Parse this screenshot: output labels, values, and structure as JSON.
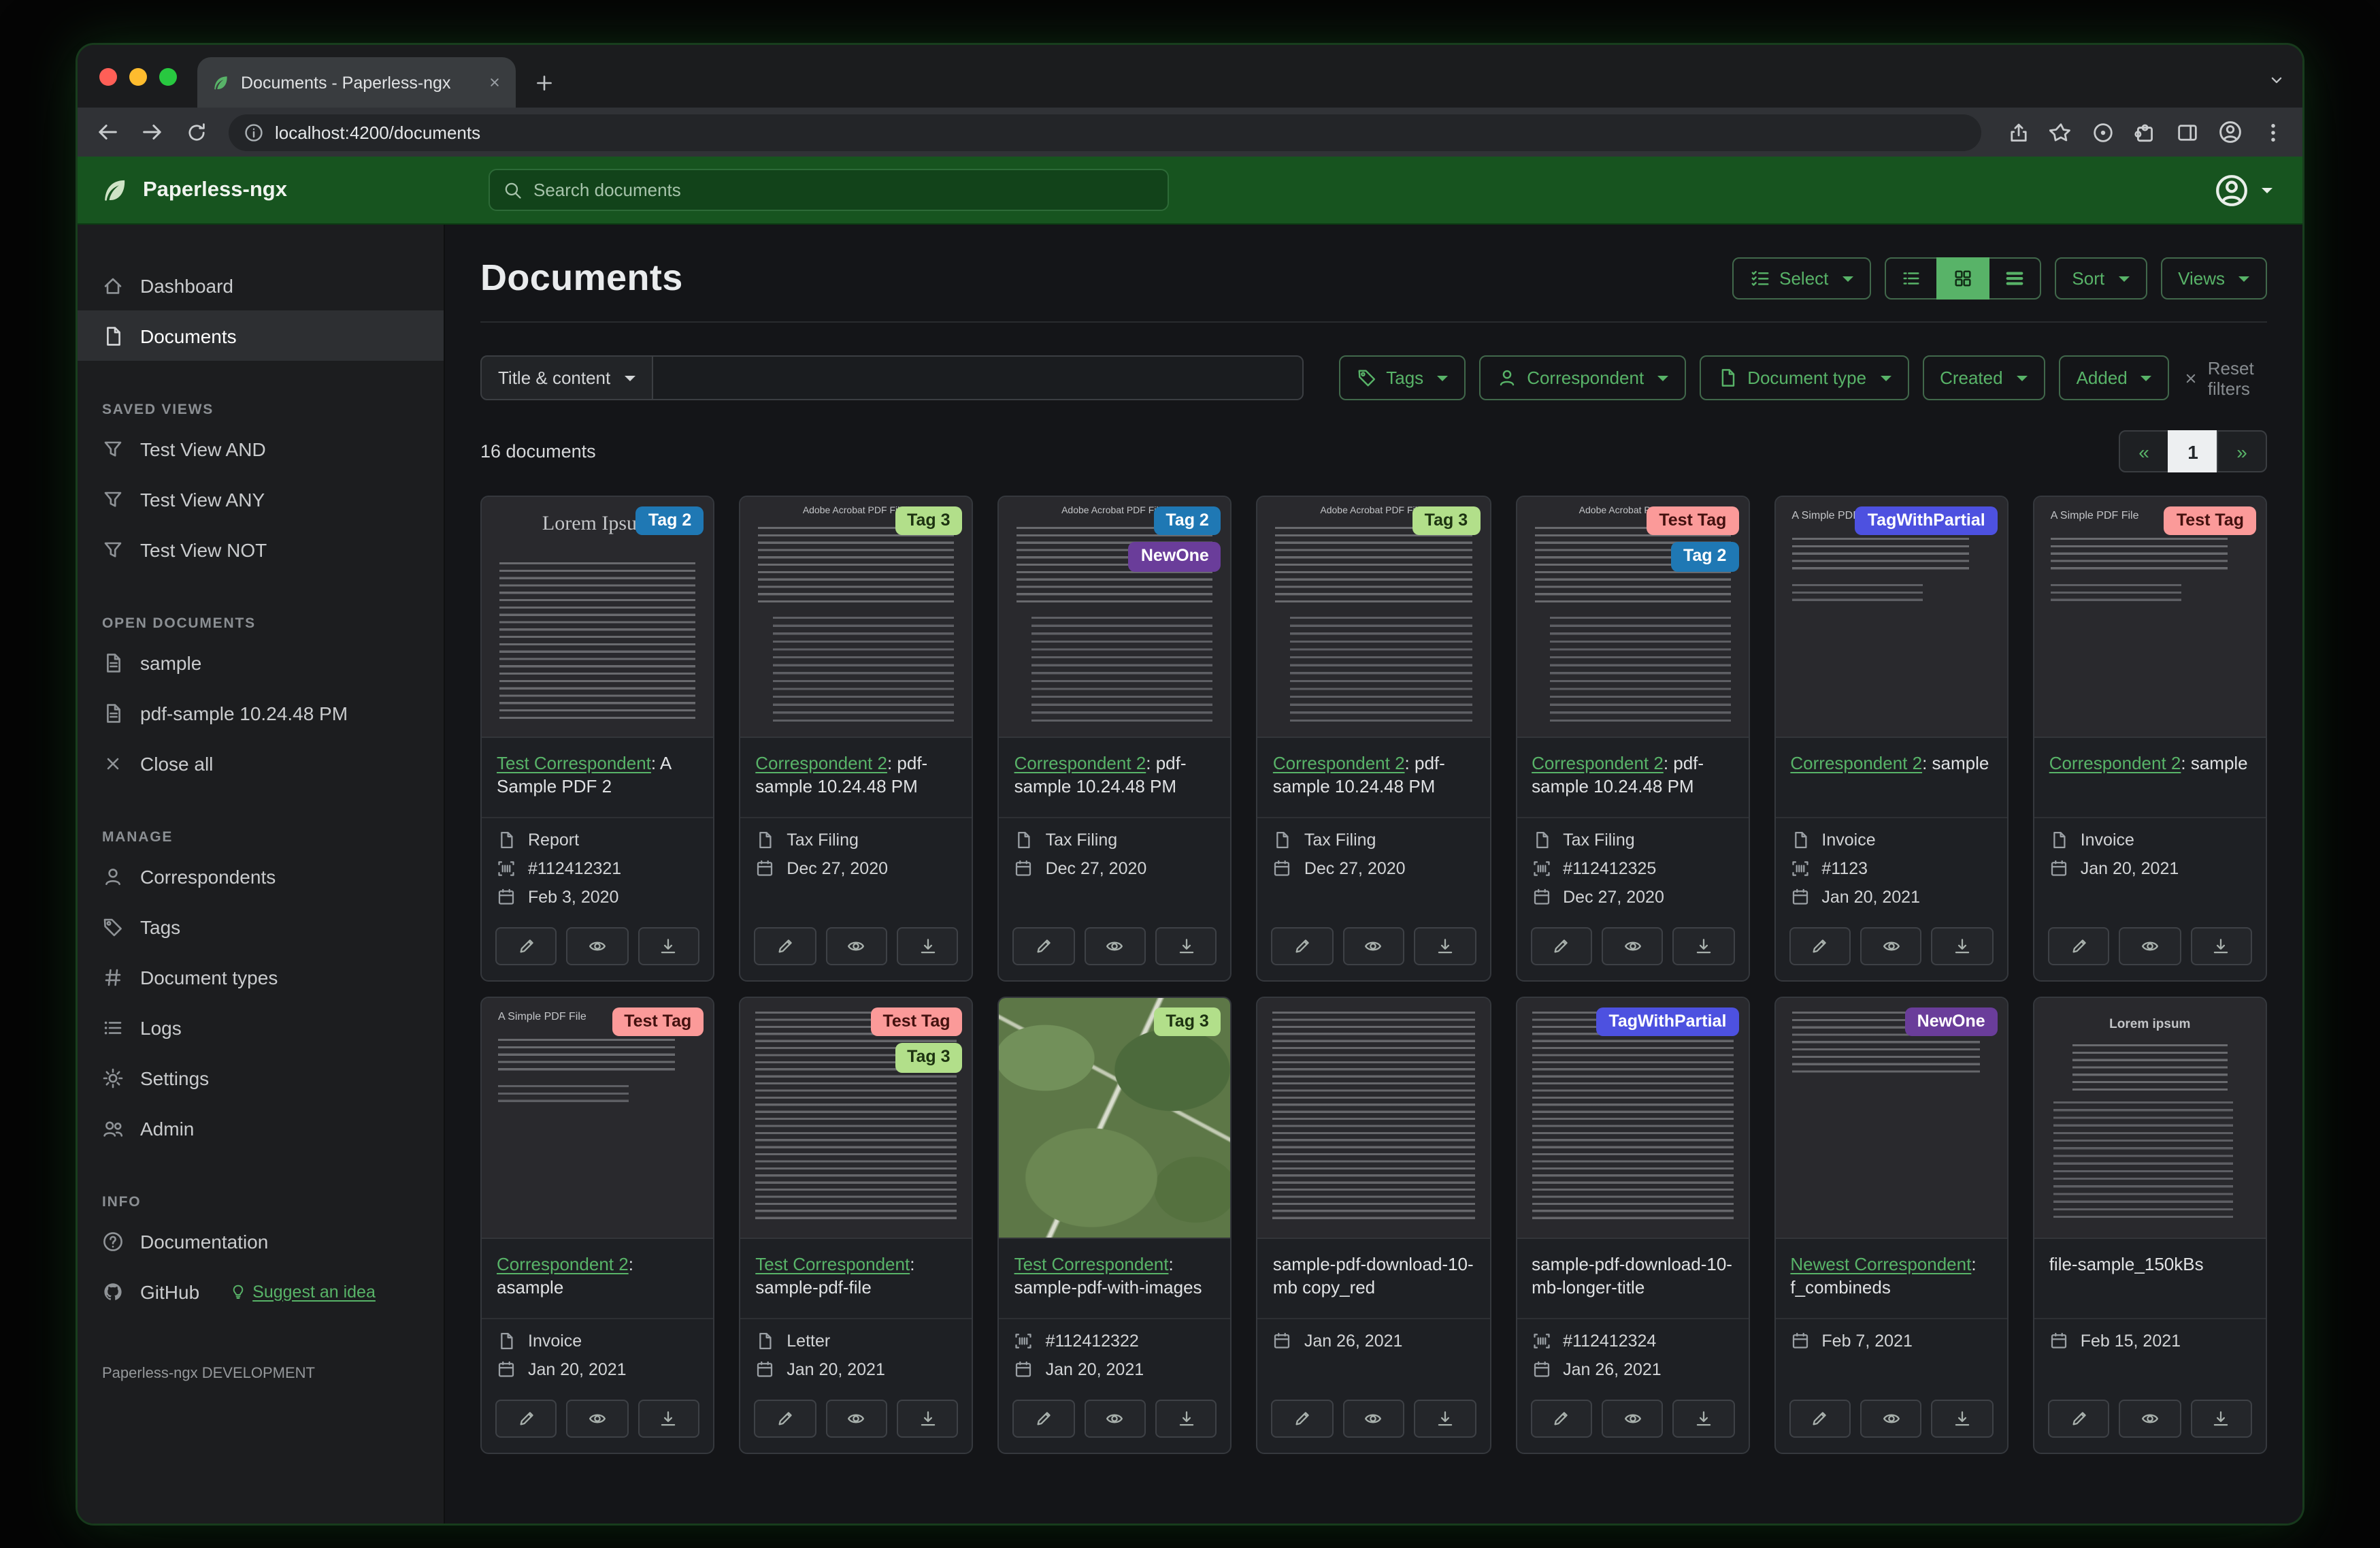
{
  "browser": {
    "tab_title": "Documents - Paperless-ngx",
    "url": "localhost:4200/documents"
  },
  "navbar": {
    "brand": "Paperless-ngx",
    "search_placeholder": "Search documents"
  },
  "sidebar": {
    "primary": [
      {
        "label": "Dashboard",
        "icon": "house"
      },
      {
        "label": "Documents",
        "icon": "file",
        "active": true
      }
    ],
    "sections": [
      {
        "heading": "SAVED VIEWS",
        "items": [
          {
            "label": "Test View AND",
            "icon": "funnel"
          },
          {
            "label": "Test View ANY",
            "icon": "funnel"
          },
          {
            "label": "Test View NOT",
            "icon": "funnel"
          }
        ]
      },
      {
        "heading": "OPEN DOCUMENTS",
        "items": [
          {
            "label": "sample",
            "icon": "file-text"
          },
          {
            "label": "pdf-sample 10.24.48 PM",
            "icon": "file-text"
          },
          {
            "label": "Close all",
            "icon": "x"
          }
        ]
      },
      {
        "heading": "MANAGE",
        "items": [
          {
            "label": "Correspondents",
            "icon": "person"
          },
          {
            "label": "Tags",
            "icon": "tag"
          },
          {
            "label": "Document types",
            "icon": "hash"
          },
          {
            "label": "Logs",
            "icon": "list"
          },
          {
            "label": "Settings",
            "icon": "gear"
          },
          {
            "label": "Admin",
            "icon": "people"
          }
        ]
      },
      {
        "heading": "INFO",
        "items": [
          {
            "label": "Documentation",
            "icon": "question"
          },
          {
            "label": "GitHub",
            "icon": "github",
            "extra": "Suggest an idea"
          }
        ]
      }
    ],
    "footer": "Paperless-ngx DEVELOPMENT"
  },
  "main": {
    "title": "Documents",
    "toolbar": {
      "select_label": "Select",
      "sort_label": "Sort",
      "views_label": "Views"
    },
    "filters": {
      "title_content_label": "Title & content",
      "tags_label": "Tags",
      "correspondent_label": "Correspondent",
      "document_type_label": "Document type",
      "created_label": "Created",
      "added_label": "Added",
      "reset_label": "Reset filters"
    },
    "count_label": "16 documents",
    "pagination": {
      "prev": "«",
      "current": "1",
      "next": "»"
    }
  },
  "colors": {
    "brand_green": "#17541f",
    "accent_green": "#58b368"
  },
  "tag_colors": {
    "Tag 2": {
      "bg": "#1f78b4",
      "fg": "#ffffff"
    },
    "Tag 3": {
      "bg": "#b2df8a",
      "fg": "#1d3311"
    },
    "Test Tag": {
      "bg": "#fb9a99",
      "fg": "#43110f"
    },
    "NewOne": {
      "bg": "#6a3d9a",
      "fg": "#ffffff"
    },
    "TagWithPartial": {
      "bg": "#4d51e0",
      "fg": "#ffffff"
    }
  },
  "documents": [
    {
      "correspondent": "Test Correspondent",
      "title": "A Sample PDF 2",
      "tags": [
        "Tag 2"
      ],
      "type": "Report",
      "asn": "#112412321",
      "date": "Feb 3, 2020",
      "thumb": "lorem-ipsum",
      "thumb_heading": "Lorem Ipsum"
    },
    {
      "correspondent": "Correspondent 2",
      "title": "pdf-sample 10.24.48 PM",
      "tags": [
        "Tag 3"
      ],
      "type": "Tax Filing",
      "date": "Dec 27, 2020",
      "thumb": "acrobat",
      "thumb_heading": "Adobe Acrobat PDF Files"
    },
    {
      "correspondent": "Correspondent 2",
      "title": "pdf-sample 10.24.48 PM",
      "tags": [
        "Tag 2",
        "NewOne"
      ],
      "type": "Tax Filing",
      "date": "Dec 27, 2020",
      "thumb": "acrobat",
      "thumb_heading": "Adobe Acrobat PDF Files"
    },
    {
      "correspondent": "Correspondent 2",
      "title": "pdf-sample 10.24.48 PM",
      "tags": [
        "Tag 3"
      ],
      "type": "Tax Filing",
      "date": "Dec 27, 2020",
      "thumb": "acrobat",
      "thumb_heading": "Adobe Acrobat PDF Files"
    },
    {
      "correspondent": "Correspondent 2",
      "title": "pdf-sample 10.24.48 PM",
      "tags": [
        "Test Tag",
        "Tag 2"
      ],
      "type": "Tax Filing",
      "asn": "#112412325",
      "date": "Dec 27, 2020",
      "thumb": "acrobat",
      "thumb_heading": "Adobe Acrobat PDF Files"
    },
    {
      "correspondent": "Correspondent 2",
      "title": "sample",
      "tags": [
        "TagWithPartial"
      ],
      "type": "Invoice",
      "asn": "#1123",
      "date": "Jan 20, 2021",
      "thumb": "simple-pdf",
      "thumb_heading": "A Simple PDF File"
    },
    {
      "correspondent": "Correspondent 2",
      "title": "sample",
      "tags": [
        "Test Tag"
      ],
      "type": "Invoice",
      "date": "Jan 20, 2021",
      "thumb": "simple-pdf",
      "thumb_heading": "A Simple PDF File"
    },
    {
      "correspondent": "Correspondent 2",
      "title": "asample",
      "tags": [
        "Test Tag"
      ],
      "type": "Invoice",
      "date": "Jan 20, 2021",
      "thumb": "simple-pdf",
      "thumb_heading": "A Simple PDF File"
    },
    {
      "correspondent": "Test Correspondent",
      "title": "sample-pdf-file",
      "tags": [
        "Test Tag",
        "Tag 3"
      ],
      "type": "Letter",
      "date": "Jan 20, 2021",
      "thumb": "dense"
    },
    {
      "correspondent": "Test Correspondent",
      "title": "sample-pdf-with-images",
      "tags": [
        "Tag 3"
      ],
      "asn": "#112412322",
      "date": "Jan 20, 2021",
      "thumb": "map"
    },
    {
      "title": "sample-pdf-download-10-mb copy_red",
      "tags": [],
      "date": "Jan 26, 2021",
      "thumb": "dense"
    },
    {
      "title": "sample-pdf-download-10-mb-longer-title",
      "tags": [
        "TagWithPartial"
      ],
      "asn": "#112412324",
      "date": "Jan 26, 2021",
      "thumb": "dense"
    },
    {
      "correspondent": "Newest Correspondent",
      "title": "f_combineds",
      "tags": [
        "NewOne"
      ],
      "date": "Feb 7, 2021",
      "thumb": "sparse"
    },
    {
      "title": "file-sample_150kBs",
      "tags": [],
      "date": "Feb 15, 2021",
      "thumb": "lorem-center",
      "thumb_heading": "Lorem ipsum"
    }
  ]
}
